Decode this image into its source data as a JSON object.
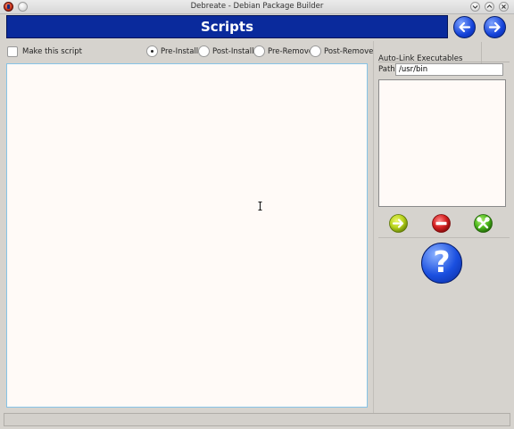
{
  "window": {
    "title": "Debreate - Debian Package Builder"
  },
  "header": {
    "title": "Scripts"
  },
  "options": {
    "make_script_label": "Make this script",
    "radios": [
      {
        "label": "Pre-Install",
        "checked": true
      },
      {
        "label": "Post-Install",
        "checked": false
      },
      {
        "label": "Pre-Remove",
        "checked": false
      },
      {
        "label": "Post-Remove",
        "checked": false
      }
    ]
  },
  "editor": {
    "content": ""
  },
  "auto_link": {
    "title": "Auto-Link Executables",
    "path_label": "Path",
    "path_value": "/usr/bin"
  },
  "icons": {
    "app": "debreate-app-icon",
    "back": "arrow-left-icon",
    "forward": "arrow-right-icon",
    "add": "add-arrow-icon",
    "remove": "remove-minus-icon",
    "tools": "tools-wrench-icon",
    "help": "help-question-icon"
  },
  "colors": {
    "header_bg": "#0a2a9c",
    "editor_border": "#86c3e6",
    "add_button": "#b6d21c",
    "remove_button": "#d42020",
    "tools_button": "#4cb81a"
  }
}
